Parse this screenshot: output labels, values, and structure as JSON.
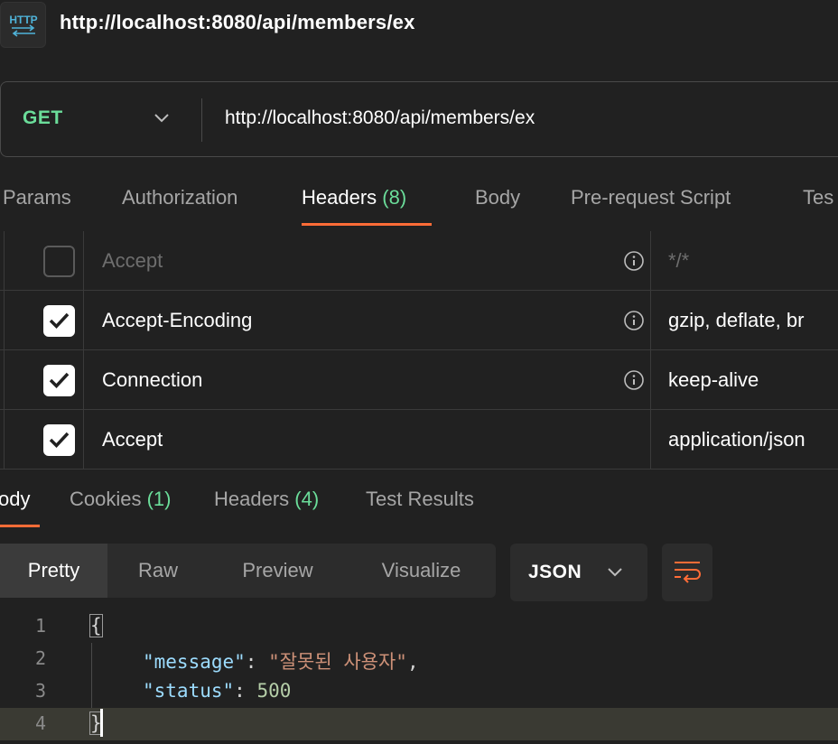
{
  "header": {
    "icon": "http-icon",
    "title": "http://localhost:8080/api/members/ex"
  },
  "request": {
    "method": "GET",
    "url": "http://localhost:8080/api/members/ex"
  },
  "request_tabs": [
    {
      "label": "Params"
    },
    {
      "label": "Authorization"
    },
    {
      "label": "Headers",
      "count": "(8)"
    },
    {
      "label": "Body"
    },
    {
      "label": "Pre-request Script"
    },
    {
      "label": "Tes"
    }
  ],
  "headers": [
    {
      "key": "Accept",
      "value": "*/*",
      "checked": false
    },
    {
      "key": "Accept-Encoding",
      "value": "gzip, deflate, br",
      "checked": true
    },
    {
      "key": "Connection",
      "value": "keep-alive",
      "checked": true
    },
    {
      "key": "Accept",
      "value": "application/json",
      "checked": true
    }
  ],
  "response_tabs": [
    {
      "label": "ody"
    },
    {
      "label": "Cookies",
      "count": "(1)"
    },
    {
      "label": "Headers",
      "count": "(4)"
    },
    {
      "label": "Test Results"
    }
  ],
  "view_modes": [
    "Pretty",
    "Raw",
    "Preview",
    "Visualize"
  ],
  "format": "JSON",
  "code": {
    "line_numbers": [
      "1",
      "2",
      "3",
      "4"
    ],
    "open_brace": "{",
    "close_brace": "}",
    "key_message": "\"message\"",
    "colon": ": ",
    "value_message": "\"잘못된 사용자\"",
    "comma": ",",
    "key_status": "\"status\"",
    "value_status": "500"
  },
  "colors": {
    "accent": "#ff6c37",
    "method_get": "#6bdd9a",
    "count": "#6bdd9a"
  }
}
